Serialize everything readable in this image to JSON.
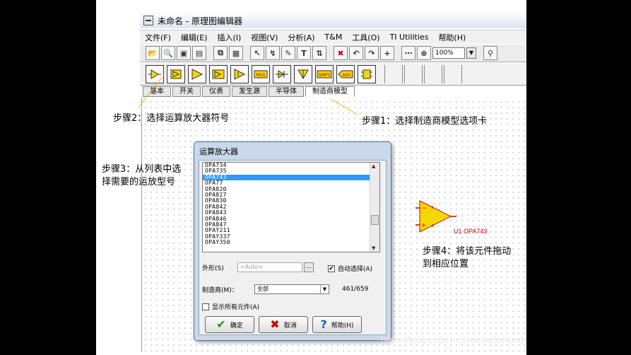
{
  "window": {
    "title": "未命名 - 原理图编辑器"
  },
  "menu": [
    "文件(F)",
    "编辑(E)",
    "插入(I)",
    "视图(V)",
    "分析(A)",
    "T&M",
    "工具(O)",
    "TI Utilities",
    "帮助(H)"
  ],
  "toolbar": {
    "zoom_value": "100%"
  },
  "tabs": [
    "基本",
    "开关",
    "仪表",
    "发生源",
    "半导体",
    "制造商模型"
  ],
  "notes": {
    "step1": "步骤1：选择制造商模型选项卡",
    "step2": "步骤2：选择运算放大器符号",
    "step3_line1": "步骤3：从列表中选",
    "step3_line2": "择需要的运放型号",
    "step4_line1": "步骤4：将该元件拖动",
    "step4_line2": "到相应位置"
  },
  "dialog": {
    "title": "运算放大器",
    "list_items": [
      "OPA734",
      "OPA735",
      "OPA743",
      "OPA77",
      "OPA820",
      "OPA827",
      "OPA830",
      "OPA842",
      "OPA843",
      "OPA846",
      "OPA847",
      "OPAY211",
      "OPAY337",
      "OPAY350"
    ],
    "selected_item": "OPA743",
    "shape_label": "外形(S)",
    "shape_value": "<Auto>",
    "auto_select_label": "自动选择(A)",
    "auto_select_checked": true,
    "manufacturer_label": "制造商(M)：",
    "manufacturer_value": "全部",
    "count": "461/659",
    "show_all_label": "显示所有元件(A)",
    "show_all_checked": false,
    "ok_label": "确定",
    "cancel_label": "取消",
    "help_label": "帮助(H)"
  },
  "component": {
    "label": "U1 OPA743",
    "color": "#f5d800"
  },
  "watermark": "https://blog.csdn.net/xuewu0zhijing"
}
